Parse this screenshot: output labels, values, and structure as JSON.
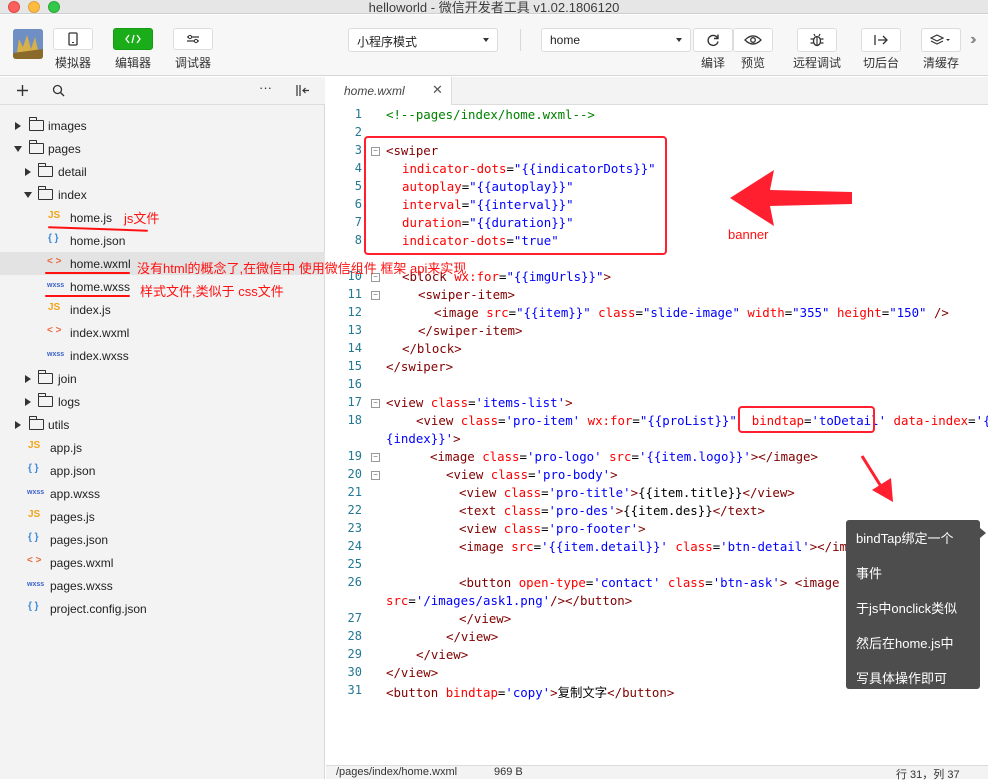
{
  "window": {
    "title": "helloworld - 微信开发者工具 v1.02.1806120"
  },
  "toolbar": {
    "simulator_label": "模拟器",
    "editor_label": "编辑器",
    "debugger_label": "调试器",
    "mode_select": "小程序模式",
    "page_select": "home",
    "compile_label": "编译",
    "preview_label": "预览",
    "remote_debug_label": "远程调试",
    "background_label": "切后台",
    "clear_cache_label": "清缓存"
  },
  "tree": {
    "items": [
      {
        "label": "images"
      },
      {
        "label": "pages"
      },
      {
        "label": "detail"
      },
      {
        "label": "index"
      },
      {
        "label": "home.js"
      },
      {
        "label": "home.json"
      },
      {
        "label": "home.wxml"
      },
      {
        "label": "home.wxss"
      },
      {
        "label": "index.js"
      },
      {
        "label": "index.wxml"
      },
      {
        "label": "index.wxss"
      },
      {
        "label": "join"
      },
      {
        "label": "logs"
      },
      {
        "label": "utils"
      },
      {
        "label": "app.js"
      },
      {
        "label": "app.json"
      },
      {
        "label": "app.wxss"
      },
      {
        "label": "pages.js"
      },
      {
        "label": "pages.json"
      },
      {
        "label": "pages.wxml"
      },
      {
        "label": "pages.wxss"
      },
      {
        "label": "project.config.json"
      }
    ],
    "icons": {
      "js": "JS",
      "json": "{ }",
      "wxml": "< >",
      "wxss": "wxss"
    }
  },
  "annotations": {
    "js_file": "js文件",
    "wxml_note": "没有html的概念了,在微信中 使用微信组件 框架 api来实现",
    "wxss_note": "样式文件,类似于  css文件",
    "banner": "banner"
  },
  "editor": {
    "tab_name": "home.wxml",
    "tab_close": "✕",
    "line_numbers": [
      "1",
      "2",
      "3",
      "4",
      "5",
      "6",
      "7",
      "8",
      "10",
      "11",
      "12",
      "13",
      "14",
      "15",
      "16",
      "17",
      "18",
      "",
      "19",
      "20",
      "21",
      "22",
      "23",
      "24",
      "25",
      "26",
      "",
      "27",
      "28",
      "29",
      "30",
      "31"
    ]
  },
  "tooltip": {
    "lines": [
      "bindTap绑定一个",
      "事件",
      "于js中onclick类似",
      "然后在home.js中",
      "写具体操作即可"
    ]
  },
  "status": {
    "path": "/pages/index/home.wxml",
    "size": "969 B",
    "position": "行 31，列 37"
  },
  "colors": {
    "accent_green": "#1aad19",
    "annotation_red": "#ff1111"
  }
}
